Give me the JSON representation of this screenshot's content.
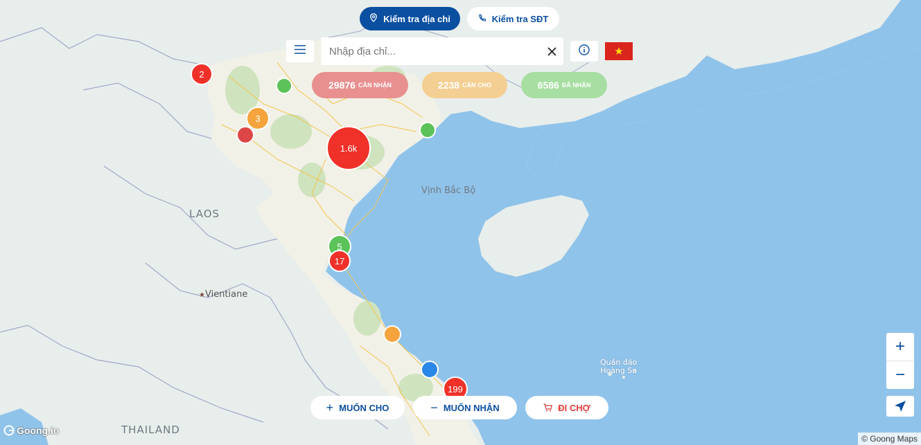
{
  "tabs": {
    "address_label": "Kiểm tra địa chỉ",
    "phone_label": "Kiểm tra SĐT"
  },
  "search": {
    "placeholder": "Nhập địa chỉ..."
  },
  "stats": {
    "need_count": "29876",
    "need_label": "CẦN NHẬN",
    "give_count": "2238",
    "give_label": "CẦN CHO",
    "received_count": "6586",
    "received_label": "ĐÃ NHẬN"
  },
  "map_labels": {
    "gulf": "Vịnh Bắc Bộ",
    "laos": "LAOS",
    "vientiane": "Vientiane",
    "thailand": "THAILAND",
    "paracel_line1": "Quần đảo",
    "paracel_line2": "Hoàng Sa"
  },
  "clusters": [
    {
      "label": "2",
      "color": "#f0312a"
    },
    {
      "label": "",
      "color": "#5cc35a"
    },
    {
      "label": "3",
      "color": "#f5a33c"
    },
    {
      "label": "",
      "color": "#dd4646"
    },
    {
      "label": "1.6k",
      "color": "#f0312a"
    },
    {
      "label": "",
      "color": "#5cc35a"
    },
    {
      "label": "5",
      "color": "#5cc35a"
    },
    {
      "label": "17",
      "color": "#f0312a"
    },
    {
      "label": "",
      "color": "#f5a33c"
    },
    {
      "label": "",
      "color": "#2b87ea"
    },
    {
      "label": "199",
      "color": "#f0312a"
    }
  ],
  "actions": {
    "give_label": "MUỐN CHO",
    "receive_label": "MUỐN NHẬN",
    "market_label": "ĐI CHỢ"
  },
  "zoom": {
    "in_label": "+",
    "out_label": "−"
  },
  "attribution": {
    "logo_text": "Goong.io",
    "copyright": "© Goong Maps"
  },
  "colors": {
    "primary": "#0b4fa0",
    "water": "#90c3ea",
    "land": "#e8eeec",
    "need": "#e89090",
    "give": "#f4cf93",
    "received": "#a7dea1",
    "market": "#e03a3a"
  }
}
